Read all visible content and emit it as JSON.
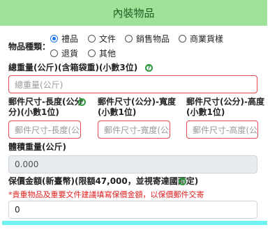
{
  "header": {
    "title": "內裝物品"
  },
  "item_type": {
    "label": "物品種類：",
    "options": [
      {
        "label": "禮品",
        "selected": true
      },
      {
        "label": "文件",
        "selected": false
      },
      {
        "label": "銷售物品",
        "selected": false
      },
      {
        "label": "商業貨樣",
        "selected": false
      },
      {
        "label": "退貨",
        "selected": false
      },
      {
        "label": "其他",
        "selected": false
      }
    ]
  },
  "total_weight": {
    "label": "總重量(公斤)(含箱袋重)(小數3位)",
    "placeholder": "總重量(公斤)"
  },
  "dimensions": {
    "length": {
      "label_line1": "郵件尺寸-長度(公分",
      "label_line2": "分)(小數1位)",
      "placeholder": "郵件尺寸-長度(公"
    },
    "width": {
      "label_line1": "郵件尺寸(公分)-寬度",
      "label_line2": "(小數1位)",
      "placeholder": "郵件尺寸-寬度(公"
    },
    "height": {
      "label_line1": "郵件尺寸(公分)-高度",
      "label_line2": "(小數1位)",
      "placeholder": "郵件尺寸-高度(公"
    }
  },
  "volumetric_weight": {
    "label": "體積重量(公斤)",
    "value": "0.000"
  },
  "insured_amount": {
    "label": "保價金額(新臺幣)(限額47,000，並視寄達國而定)",
    "warning": "*貴重物品及重要文件建議填寫保價金額，以保價郵件交寄",
    "value": "0"
  },
  "icons": {
    "help": "help-icon"
  },
  "colors": {
    "header_bg": "#9fe39a",
    "error_border": "#e0484e",
    "warning_text": "#e02020",
    "help_green": "#2e9a3e"
  }
}
